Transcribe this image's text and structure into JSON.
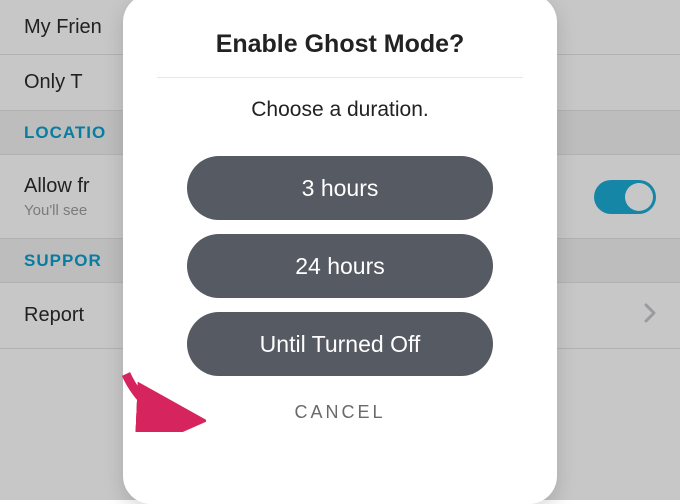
{
  "background": {
    "rows": [
      {
        "label": "My Frien"
      },
      {
        "label": "Only T"
      }
    ],
    "section_location": "LOCATIO",
    "allow": {
      "label": "Allow fr",
      "sub": "You'll see"
    },
    "section_support": "SUPPOR",
    "report": "Report"
  },
  "modal": {
    "title": "Enable Ghost Mode?",
    "subtitle": "Choose a duration.",
    "options": [
      "3 hours",
      "24 hours",
      "Until Turned Off"
    ],
    "cancel": "CANCEL"
  }
}
